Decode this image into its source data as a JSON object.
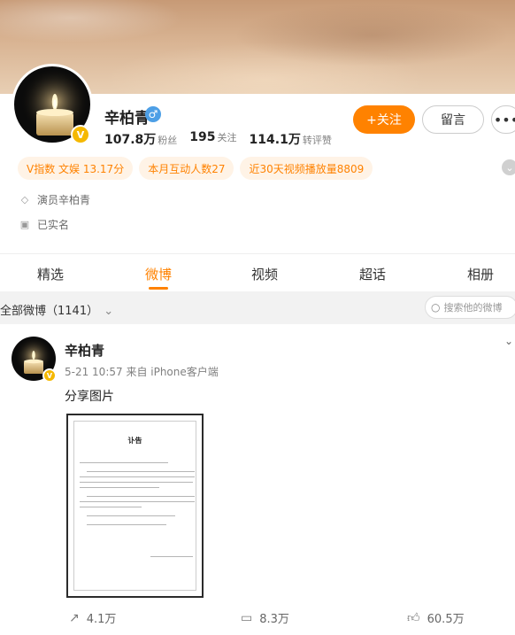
{
  "profile": {
    "name": "辛柏青",
    "gender_symbol": "♂",
    "verified_symbol": "V",
    "stats": [
      {
        "value": "107.8万",
        "label": "粉丝"
      },
      {
        "value": "195",
        "label": "关注"
      },
      {
        "value": "114.1万",
        "label": "转评赞"
      }
    ],
    "follow_label": "+关注",
    "message_label": "留言",
    "more_label": "•••"
  },
  "tags": [
    "V指数 文娱 13.17分",
    "本月互动人数27",
    "近30天视频播放量8809"
  ],
  "info": [
    {
      "icon": "shield-icon",
      "text": "演员辛柏青"
    },
    {
      "icon": "id-card-icon",
      "text": "已实名"
    }
  ],
  "tabs": [
    "精选",
    "微博",
    "视频",
    "超话",
    "相册"
  ],
  "active_tab": "微博",
  "filter": {
    "label": "全部微博（1141）",
    "search_placeholder": "搜索他的微博"
  },
  "post": {
    "author": "辛柏青",
    "meta": "5-21 10:57  来自 iPhone客户端",
    "text": "分享图片",
    "image_title": "讣告",
    "actions": [
      {
        "icon": "share-icon",
        "count": "4.1万"
      },
      {
        "icon": "comment-icon",
        "count": "8.3万"
      },
      {
        "icon": "like-icon",
        "count": "60.5万"
      }
    ]
  },
  "colors": {
    "accent": "#ff8200",
    "verified": "#f5b800",
    "gender": "#4d9fe6"
  }
}
